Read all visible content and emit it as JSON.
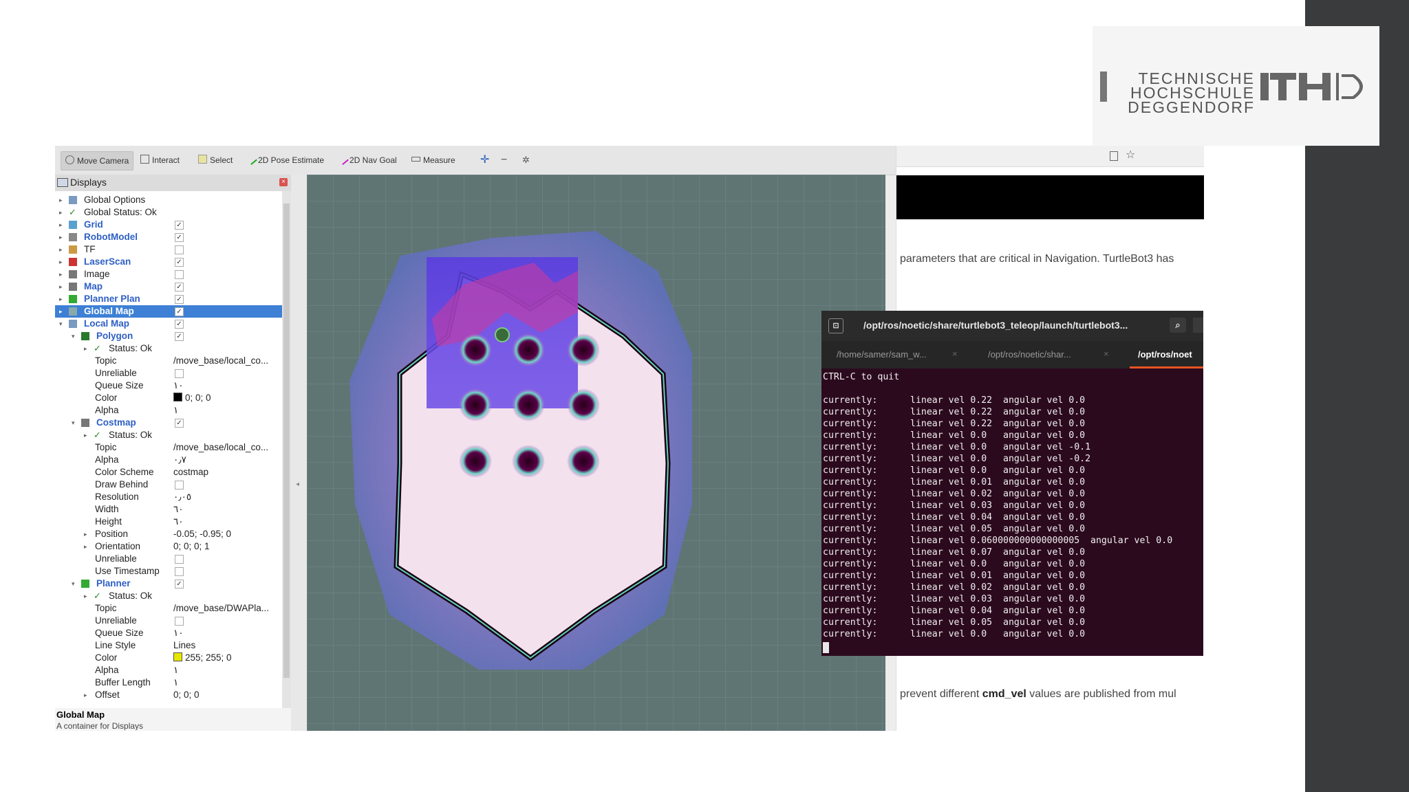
{
  "logo": {
    "lines": [
      "TECHNISCHE",
      "HOCHSCHULE",
      "DEGGENDORF"
    ],
    "mark": "THD"
  },
  "toolbar": {
    "tools": [
      "Move Camera",
      "Interact",
      "Select",
      "2D Pose Estimate",
      "2D Nav Goal",
      "Measure"
    ]
  },
  "displays": {
    "title": "Displays",
    "rows": [
      {
        "label": "Global Options",
        "value": ""
      },
      {
        "label": "Global Status: Ok",
        "value": ""
      },
      {
        "label": "Grid",
        "value": "✓"
      },
      {
        "label": "RobotModel",
        "value": "✓"
      },
      {
        "label": "TF",
        "value": ""
      },
      {
        "label": "LaserScan",
        "value": "✓"
      },
      {
        "label": "Image",
        "value": ""
      },
      {
        "label": "Map",
        "value": "✓"
      },
      {
        "label": "Planner Plan",
        "value": "✓"
      },
      {
        "label": "Global Map",
        "value": "✓"
      },
      {
        "label": "Local Map",
        "value": "✓"
      },
      {
        "label": "Polygon",
        "value": "✓"
      },
      {
        "label": "Status: Ok",
        "value": ""
      },
      {
        "label": "Topic",
        "value": "/move_base/local_co..."
      },
      {
        "label": "Unreliable",
        "value": ""
      },
      {
        "label": "Queue Size",
        "value": "١٠"
      },
      {
        "label": "Color",
        "value": "0; 0; 0"
      },
      {
        "label": "Alpha",
        "value": "١"
      },
      {
        "label": "Costmap",
        "value": "✓"
      },
      {
        "label": "Status: Ok",
        "value": ""
      },
      {
        "label": "Topic",
        "value": "/move_base/local_co..."
      },
      {
        "label": "Alpha",
        "value": "٠٫٧"
      },
      {
        "label": "Color Scheme",
        "value": "costmap"
      },
      {
        "label": "Draw Behind",
        "value": ""
      },
      {
        "label": "Resolution",
        "value": "٠٫٠٥"
      },
      {
        "label": "Width",
        "value": "٦٠"
      },
      {
        "label": "Height",
        "value": "٦٠"
      },
      {
        "label": "Position",
        "value": "-0.05; -0.95; 0"
      },
      {
        "label": "Orientation",
        "value": "0; 0; 0; 1"
      },
      {
        "label": "Unreliable",
        "value": ""
      },
      {
        "label": "Use Timestamp",
        "value": ""
      },
      {
        "label": "Planner",
        "value": "✓"
      },
      {
        "label": "Status: Ok",
        "value": ""
      },
      {
        "label": "Topic",
        "value": "/move_base/DWAPla..."
      },
      {
        "label": "Unreliable",
        "value": ""
      },
      {
        "label": "Queue Size",
        "value": "١٠"
      },
      {
        "label": "Line Style",
        "value": "Lines"
      },
      {
        "label": "Color",
        "value": "255; 255; 0"
      },
      {
        "label": "Alpha",
        "value": "١"
      },
      {
        "label": "Buffer Length",
        "value": "١"
      },
      {
        "label": "Offset",
        "value": "0; 0; 0"
      }
    ],
    "description_title": "Global Map",
    "description_text": "A container for Displays"
  },
  "browser": {
    "line1": "parameters that are critical in Navigation. TurtleBot3 has",
    "line2_prefix": "prevent different ",
    "line2_bold": "cmd_vel",
    "line2_suffix": " values are published from mul"
  },
  "terminal": {
    "title": "/opt/ros/noetic/share/turtlebot3_teleop/launch/turtlebot3...",
    "tabs": [
      "/home/samer/sam_w...",
      "/opt/ros/noetic/shar...",
      "/opt/ros/noet"
    ],
    "lines": [
      "CTRL-C to quit",
      "",
      "currently:      linear vel 0.22  angular vel 0.0",
      "currently:      linear vel 0.22  angular vel 0.0",
      "currently:      linear vel 0.22  angular vel 0.0",
      "currently:      linear vel 0.0   angular vel 0.0",
      "currently:      linear vel 0.0   angular vel -0.1",
      "currently:      linear vel 0.0   angular vel -0.2",
      "currently:      linear vel 0.0   angular vel 0.0",
      "currently:      linear vel 0.01  angular vel 0.0",
      "currently:      linear vel 0.02  angular vel 0.0",
      "currently:      linear vel 0.03  angular vel 0.0",
      "currently:      linear vel 0.04  angular vel 0.0",
      "currently:      linear vel 0.05  angular vel 0.0",
      "currently:      linear vel 0.060000000000000005  angular vel 0.0",
      "currently:      linear vel 0.07  angular vel 0.0",
      "currently:      linear vel 0.0   angular vel 0.0",
      "currently:      linear vel 0.01  angular vel 0.0",
      "currently:      linear vel 0.02  angular vel 0.0",
      "currently:      linear vel 0.03  angular vel 0.0",
      "currently:      linear vel 0.04  angular vel 0.0",
      "currently:      linear vel 0.05  angular vel 0.0",
      "currently:      linear vel 0.0   angular vel 0.0"
    ]
  }
}
